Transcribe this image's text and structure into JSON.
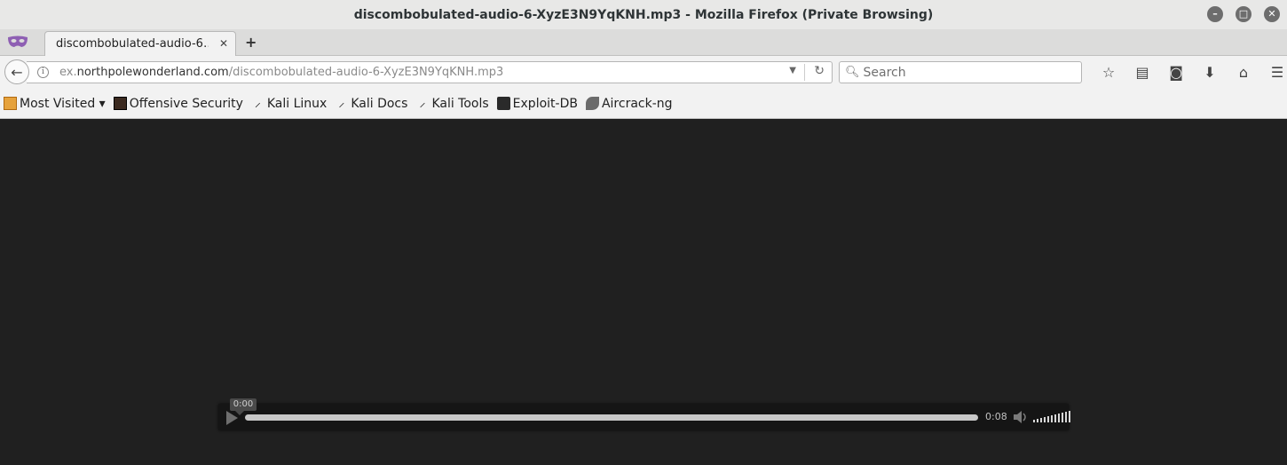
{
  "window": {
    "title": "discombobulated-audio-6-XyzE3N9YqKNH.mp3 - Mozilla Firefox (Private Browsing)",
    "controls": [
      "minimize",
      "maximize",
      "close"
    ]
  },
  "tabs": [
    {
      "label": "discombobulated-audio-6…",
      "active": true
    }
  ],
  "navbar": {
    "url_prefix": "ex.",
    "url_host": "northpolewonderland.com",
    "url_path": "/discombobulated-audio-6-XyzE3N9YqKNH.mp3",
    "search_placeholder": "Search",
    "icons": [
      "bookmark-star-icon",
      "reading-list-icon",
      "pocket-icon",
      "download-icon",
      "home-icon",
      "menu-icon"
    ]
  },
  "bookmarks": [
    {
      "label": "Most Visited ▾",
      "icon": "folder-icon"
    },
    {
      "label": "Offensive Security",
      "icon": "offsec-icon"
    },
    {
      "label": "Kali Linux",
      "icon": "kali-icon"
    },
    {
      "label": "Kali Docs",
      "icon": "kali-icon"
    },
    {
      "label": "Kali Tools",
      "icon": "kali-icon"
    },
    {
      "label": "Exploit-DB",
      "icon": "exploitdb-icon"
    },
    {
      "label": "Aircrack-ng",
      "icon": "aircrack-icon"
    }
  ],
  "player": {
    "current_time": "0:00",
    "duration": "0:08",
    "progress": 0.0,
    "volume_level": 1.0,
    "colors": {
      "background": "#151515",
      "track": "#c8c8c8"
    }
  }
}
